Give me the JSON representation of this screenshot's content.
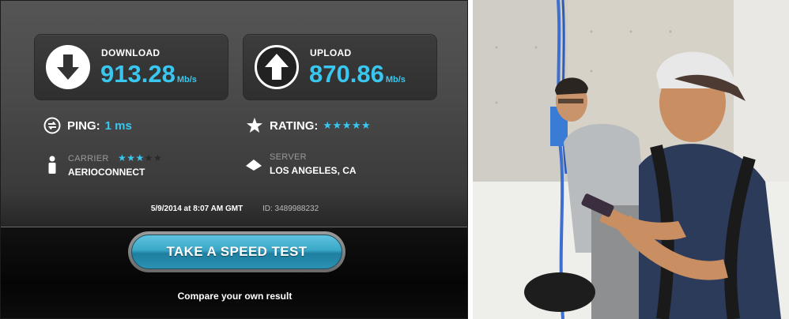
{
  "download": {
    "label": "DOWNLOAD",
    "value": "913.28",
    "unit": "Mb/s",
    "icon": "arrow-down-icon"
  },
  "upload": {
    "label": "UPLOAD",
    "value": "870.86",
    "unit": "Mb/s",
    "icon": "arrow-up-icon"
  },
  "ping": {
    "label": "PING:",
    "value": "1 ms",
    "icon": "ping-icon"
  },
  "rating": {
    "label": "RATING:",
    "stars": "★★★★★",
    "star_count": 5,
    "icon": "star-icon"
  },
  "carrier": {
    "label": "CARRIER",
    "name": "AERIOCONNECT",
    "stars_filled": "★★★",
    "stars_empty": "★★",
    "star_count": 3,
    "icon": "person-icon"
  },
  "server": {
    "label": "SERVER",
    "location": "LOS ANGELES, CA",
    "icon": "server-icon"
  },
  "footer": {
    "timestamp": "5/9/2014 at 8:07 AM GMT",
    "id": "ID: 3489988232"
  },
  "cta": {
    "button_label": "TAKE A SPEED TEST",
    "compare_label": "Compare your own result"
  },
  "colors": {
    "accent": "#39c7f0",
    "panel": "#4a4a4a",
    "button": "#3aa7c8"
  }
}
